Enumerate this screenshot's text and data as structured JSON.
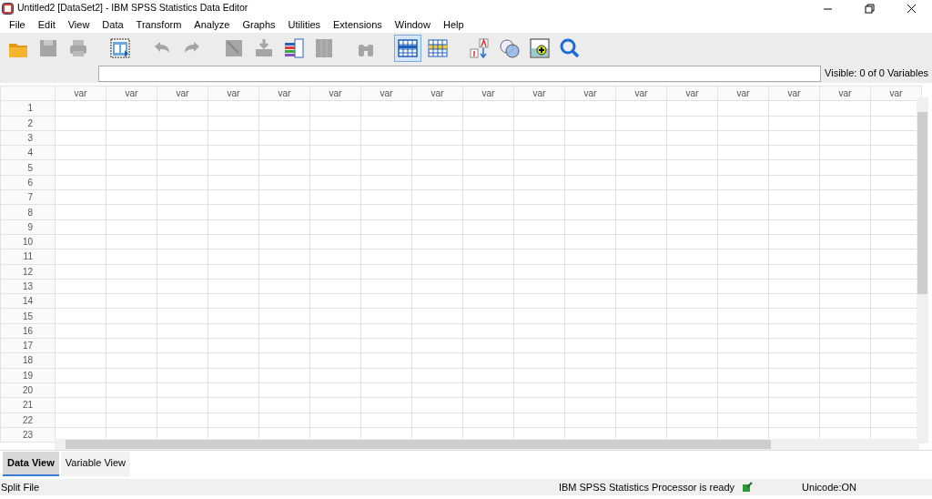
{
  "window": {
    "title": "Untitled2 [DataSet2] - IBM SPSS Statistics Data Editor"
  },
  "menu": [
    {
      "label": "File"
    },
    {
      "label": "Edit"
    },
    {
      "label": "View"
    },
    {
      "label": "Data"
    },
    {
      "label": "Transform"
    },
    {
      "label": "Analyze"
    },
    {
      "label": "Graphs"
    },
    {
      "label": "Utilities"
    },
    {
      "label": "Extensions"
    },
    {
      "label": "Window"
    },
    {
      "label": "Help"
    }
  ],
  "toolbar": [
    {
      "kind": "open",
      "disabled": false,
      "selected": false
    },
    {
      "kind": "save",
      "disabled": true,
      "selected": false
    },
    {
      "kind": "print",
      "disabled": true,
      "selected": false
    },
    {
      "kind": "recall",
      "disabled": false,
      "selected": false
    },
    {
      "kind": "undo",
      "disabled": true,
      "selected": false
    },
    {
      "kind": "redo",
      "disabled": true,
      "selected": false
    },
    {
      "kind": "goto-case",
      "disabled": true,
      "selected": false
    },
    {
      "kind": "goto-var",
      "disabled": true,
      "selected": false
    },
    {
      "kind": "variables",
      "disabled": false,
      "selected": false
    },
    {
      "kind": "run-desc",
      "disabled": true,
      "selected": false
    },
    {
      "kind": "find",
      "disabled": true,
      "selected": false
    },
    {
      "kind": "insert-cases",
      "disabled": false,
      "selected": true
    },
    {
      "kind": "insert-var",
      "disabled": false,
      "selected": false
    },
    {
      "kind": "value-labels",
      "disabled": false,
      "selected": false
    },
    {
      "kind": "sets",
      "disabled": false,
      "selected": false
    },
    {
      "kind": "spell",
      "disabled": false,
      "selected": false
    },
    {
      "kind": "search",
      "disabled": false,
      "selected": false
    }
  ],
  "cell_editor": {
    "visible_label": "Visible: 0 of 0 Variables"
  },
  "grid": {
    "columns": [
      "var",
      "var",
      "var",
      "var",
      "var",
      "var",
      "var",
      "var",
      "var",
      "var",
      "var",
      "var",
      "var",
      "var",
      "var",
      "var",
      "var"
    ],
    "rows": [
      "1",
      "2",
      "3",
      "4",
      "5",
      "6",
      "7",
      "8",
      "9",
      "10",
      "11",
      "12",
      "13",
      "14",
      "15",
      "16",
      "17",
      "18",
      "19",
      "20",
      "21",
      "22",
      "23"
    ]
  },
  "view_tabs": [
    {
      "label": "Data View",
      "selected": true
    },
    {
      "label": "Variable View",
      "selected": false
    }
  ],
  "status_bar": {
    "left": "Split File",
    "processor": "IBM SPSS Statistics Processor is ready",
    "unicode": "Unicode:ON"
  }
}
